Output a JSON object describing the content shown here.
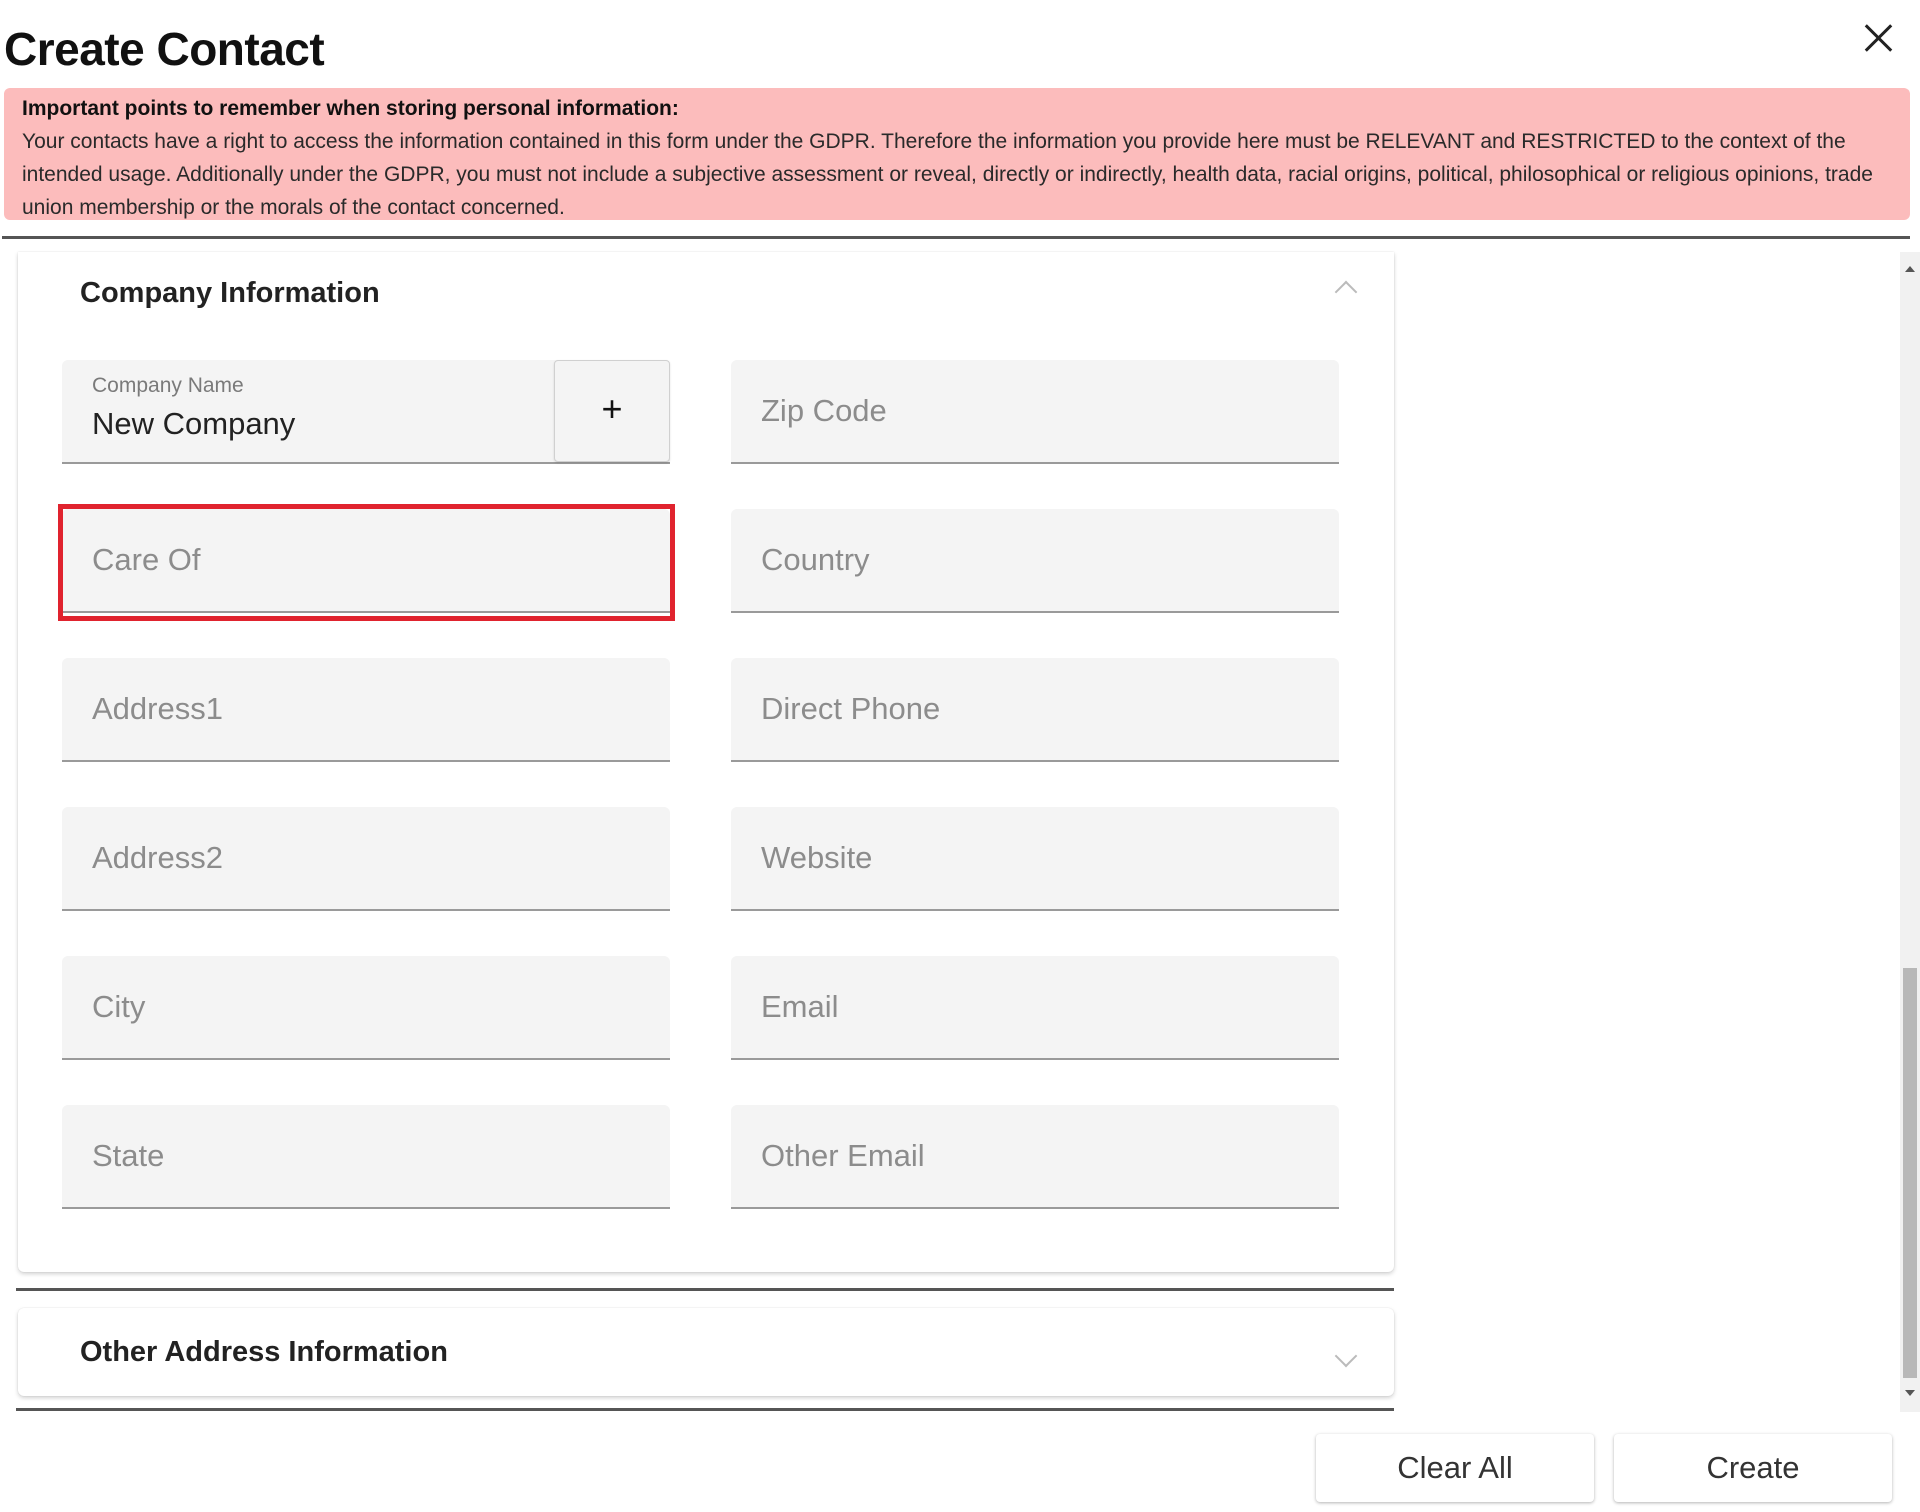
{
  "dialog": {
    "title": "Create Contact"
  },
  "notice": {
    "heading": "Important points to remember when storing personal information:",
    "body": "Your contacts have a right to access the information contained in this form under the GDPR. Therefore the information you provide here must be RELEVANT and RESTRICTED to the context of the intended usage. Additionally under the GDPR, you must not include a subjective assessment or reveal, directly or indirectly, health data, racial origins, political, philosophical or religious opinions, trade union membership or the morals of the contact concerned."
  },
  "company_section": {
    "title": "Company Information",
    "company_name": {
      "label": "Company Name",
      "value": "New Company",
      "add_label": "+"
    },
    "left_fields": [
      "Care Of",
      "Address1",
      "Address2",
      "City",
      "State"
    ],
    "right_fields": [
      "Zip Code",
      "Country",
      "Direct Phone",
      "Website",
      "Email",
      "Other Email"
    ]
  },
  "other_address_section": {
    "title": "Other Address Information"
  },
  "footer": {
    "clear_label": "Clear All",
    "create_label": "Create"
  },
  "colors": {
    "notice_bg": "#fcbcbc",
    "highlight": "#e0232e",
    "field_bg": "#f4f4f4"
  }
}
